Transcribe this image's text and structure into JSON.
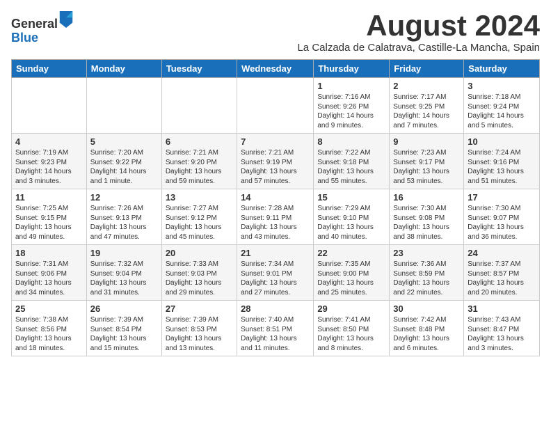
{
  "logo": {
    "general": "General",
    "blue": "Blue"
  },
  "title": {
    "month": "August 2024",
    "location": "La Calzada de Calatrava, Castille-La Mancha, Spain"
  },
  "header_color": "#1a6fba",
  "days_of_week": [
    "Sunday",
    "Monday",
    "Tuesday",
    "Wednesday",
    "Thursday",
    "Friday",
    "Saturday"
  ],
  "weeks": [
    [
      {
        "day": "",
        "info": ""
      },
      {
        "day": "",
        "info": ""
      },
      {
        "day": "",
        "info": ""
      },
      {
        "day": "",
        "info": ""
      },
      {
        "day": "1",
        "info": "Sunrise: 7:16 AM\nSunset: 9:26 PM\nDaylight: 14 hours and 9 minutes."
      },
      {
        "day": "2",
        "info": "Sunrise: 7:17 AM\nSunset: 9:25 PM\nDaylight: 14 hours and 7 minutes."
      },
      {
        "day": "3",
        "info": "Sunrise: 7:18 AM\nSunset: 9:24 PM\nDaylight: 14 hours and 5 minutes."
      }
    ],
    [
      {
        "day": "4",
        "info": "Sunrise: 7:19 AM\nSunset: 9:23 PM\nDaylight: 14 hours and 3 minutes."
      },
      {
        "day": "5",
        "info": "Sunrise: 7:20 AM\nSunset: 9:22 PM\nDaylight: 14 hours and 1 minute."
      },
      {
        "day": "6",
        "info": "Sunrise: 7:21 AM\nSunset: 9:20 PM\nDaylight: 13 hours and 59 minutes."
      },
      {
        "day": "7",
        "info": "Sunrise: 7:21 AM\nSunset: 9:19 PM\nDaylight: 13 hours and 57 minutes."
      },
      {
        "day": "8",
        "info": "Sunrise: 7:22 AM\nSunset: 9:18 PM\nDaylight: 13 hours and 55 minutes."
      },
      {
        "day": "9",
        "info": "Sunrise: 7:23 AM\nSunset: 9:17 PM\nDaylight: 13 hours and 53 minutes."
      },
      {
        "day": "10",
        "info": "Sunrise: 7:24 AM\nSunset: 9:16 PM\nDaylight: 13 hours and 51 minutes."
      }
    ],
    [
      {
        "day": "11",
        "info": "Sunrise: 7:25 AM\nSunset: 9:15 PM\nDaylight: 13 hours and 49 minutes."
      },
      {
        "day": "12",
        "info": "Sunrise: 7:26 AM\nSunset: 9:13 PM\nDaylight: 13 hours and 47 minutes."
      },
      {
        "day": "13",
        "info": "Sunrise: 7:27 AM\nSunset: 9:12 PM\nDaylight: 13 hours and 45 minutes."
      },
      {
        "day": "14",
        "info": "Sunrise: 7:28 AM\nSunset: 9:11 PM\nDaylight: 13 hours and 43 minutes."
      },
      {
        "day": "15",
        "info": "Sunrise: 7:29 AM\nSunset: 9:10 PM\nDaylight: 13 hours and 40 minutes."
      },
      {
        "day": "16",
        "info": "Sunrise: 7:30 AM\nSunset: 9:08 PM\nDaylight: 13 hours and 38 minutes."
      },
      {
        "day": "17",
        "info": "Sunrise: 7:30 AM\nSunset: 9:07 PM\nDaylight: 13 hours and 36 minutes."
      }
    ],
    [
      {
        "day": "18",
        "info": "Sunrise: 7:31 AM\nSunset: 9:06 PM\nDaylight: 13 hours and 34 minutes."
      },
      {
        "day": "19",
        "info": "Sunrise: 7:32 AM\nSunset: 9:04 PM\nDaylight: 13 hours and 31 minutes."
      },
      {
        "day": "20",
        "info": "Sunrise: 7:33 AM\nSunset: 9:03 PM\nDaylight: 13 hours and 29 minutes."
      },
      {
        "day": "21",
        "info": "Sunrise: 7:34 AM\nSunset: 9:01 PM\nDaylight: 13 hours and 27 minutes."
      },
      {
        "day": "22",
        "info": "Sunrise: 7:35 AM\nSunset: 9:00 PM\nDaylight: 13 hours and 25 minutes."
      },
      {
        "day": "23",
        "info": "Sunrise: 7:36 AM\nSunset: 8:59 PM\nDaylight: 13 hours and 22 minutes."
      },
      {
        "day": "24",
        "info": "Sunrise: 7:37 AM\nSunset: 8:57 PM\nDaylight: 13 hours and 20 minutes."
      }
    ],
    [
      {
        "day": "25",
        "info": "Sunrise: 7:38 AM\nSunset: 8:56 PM\nDaylight: 13 hours and 18 minutes."
      },
      {
        "day": "26",
        "info": "Sunrise: 7:39 AM\nSunset: 8:54 PM\nDaylight: 13 hours and 15 minutes."
      },
      {
        "day": "27",
        "info": "Sunrise: 7:39 AM\nSunset: 8:53 PM\nDaylight: 13 hours and 13 minutes."
      },
      {
        "day": "28",
        "info": "Sunrise: 7:40 AM\nSunset: 8:51 PM\nDaylight: 13 hours and 11 minutes."
      },
      {
        "day": "29",
        "info": "Sunrise: 7:41 AM\nSunset: 8:50 PM\nDaylight: 13 hours and 8 minutes."
      },
      {
        "day": "30",
        "info": "Sunrise: 7:42 AM\nSunset: 8:48 PM\nDaylight: 13 hours and 6 minutes."
      },
      {
        "day": "31",
        "info": "Sunrise: 7:43 AM\nSunset: 8:47 PM\nDaylight: 13 hours and 3 minutes."
      }
    ]
  ]
}
